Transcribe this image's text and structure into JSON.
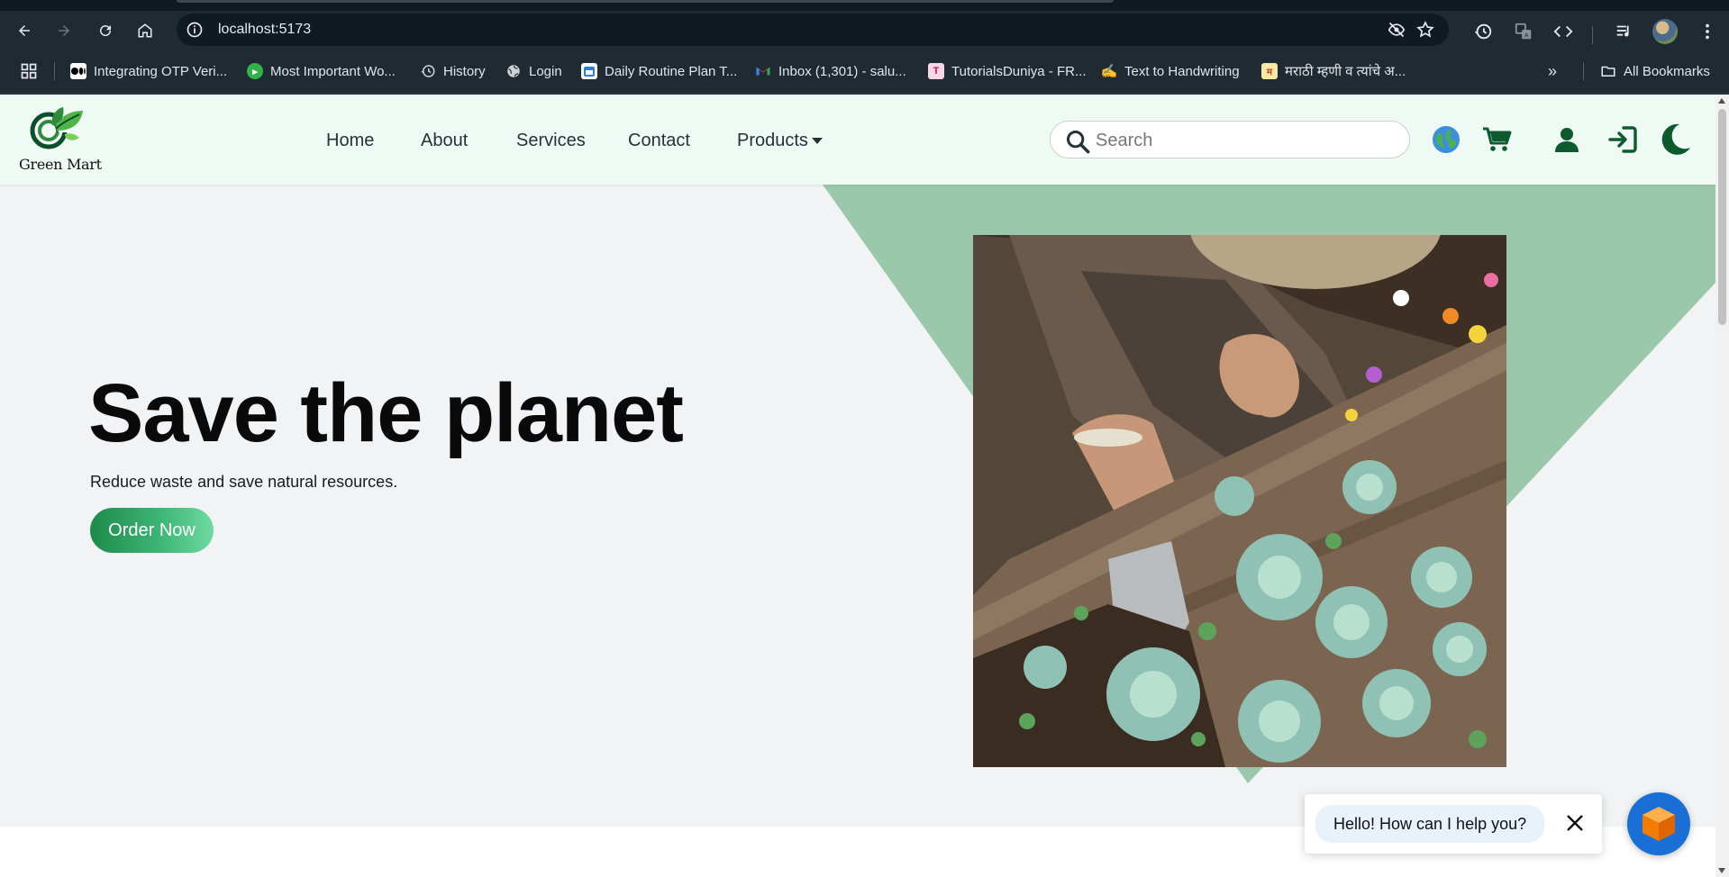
{
  "browser": {
    "url": "localhost:5173",
    "icons": [
      "back-icon",
      "forward-icon",
      "reload-icon",
      "home-icon",
      "site-info-icon",
      "eye-off-icon",
      "star-icon",
      "history-icon",
      "translate-icon",
      "code-icon",
      "media-icon",
      "menu-icon"
    ],
    "bookmarks": [
      {
        "label": "Integrating OTP Veri...",
        "icon": "medium-icon",
        "color": "#000000"
      },
      {
        "label": "Most Important Wo...",
        "icon": "green-leaf-icon",
        "color": "#2fb34a"
      },
      {
        "label": "History",
        "icon": "history-icon",
        "color": "#cfd3d6"
      },
      {
        "label": "Login",
        "icon": "globe-icon",
        "color": "#cfd3d6"
      },
      {
        "label": "Daily Routine Plan T...",
        "icon": "calendar-icon",
        "color": "#2d7be5"
      },
      {
        "label": "Inbox (1,301) - salu...",
        "icon": "gmail-icon",
        "color": "#ea4335"
      },
      {
        "label": "TutorialsDuniya - FR...",
        "icon": "book-icon",
        "color": "#c2185b"
      },
      {
        "label": "Text to Handwriting",
        "icon": "pen-hand-icon",
        "color": "#f3c63f"
      },
      {
        "label": "मराठी म्हणी व त्यांचे अ...",
        "icon": "marathi-site-icon",
        "color": "#d32f2f"
      }
    ],
    "more_bookmarks": "»",
    "all_bookmarks": "All Bookmarks"
  },
  "site": {
    "brand": "Green Mart",
    "nav": {
      "home": "Home",
      "about": "About",
      "services": "Services",
      "contact": "Contact",
      "products": "Products"
    },
    "search": {
      "placeholder": "Search"
    },
    "header_icons": [
      "globe-icon",
      "cart-icon",
      "user-icon",
      "login-icon",
      "moon-icon"
    ]
  },
  "hero": {
    "title": "Save the planet",
    "subtitle": "Reduce waste and save natural resources.",
    "cta": "Order Now",
    "accent_color": "#9bc8ab",
    "button_color": "#1f8a4a"
  },
  "chat": {
    "message": "Hello! How can I help you?",
    "launcher_color": "#1a6fd6"
  }
}
